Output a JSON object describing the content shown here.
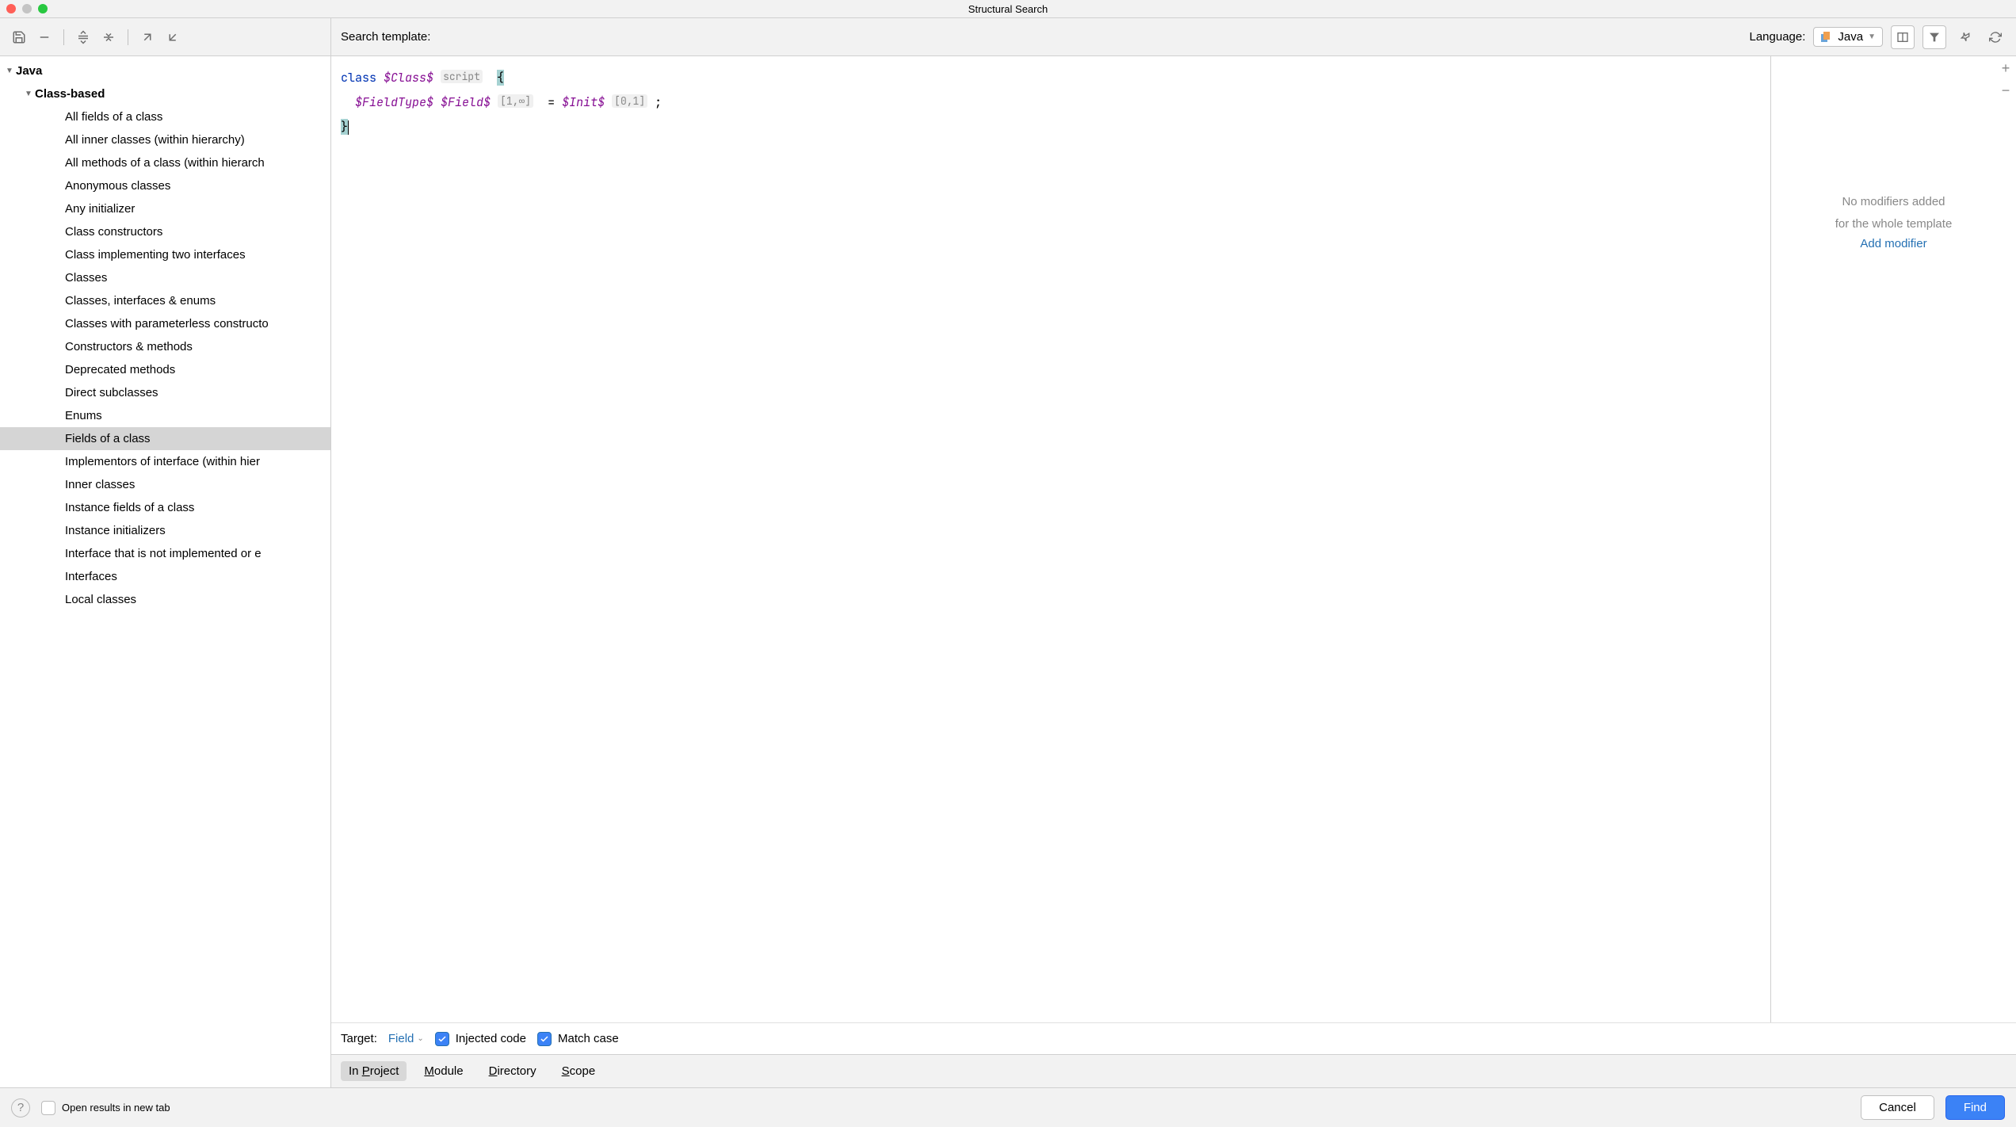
{
  "window": {
    "title": "Structural Search"
  },
  "tree": {
    "root": {
      "label": "Java"
    },
    "group": {
      "label": "Class-based"
    },
    "items": [
      "All fields of a class",
      "All inner classes (within hierarchy)",
      "All methods of a class (within hierarch",
      "Anonymous classes",
      "Any initializer",
      "Class constructors",
      "Class implementing two interfaces",
      "Classes",
      "Classes, interfaces & enums",
      "Classes with parameterless constructo",
      "Constructors & methods",
      "Deprecated methods",
      "Direct subclasses",
      "Enums",
      "Fields of a class",
      "Implementors of interface (within hier",
      "Inner classes",
      "Instance fields of a class",
      "Instance initializers",
      "Interface that is not implemented or e",
      "Interfaces",
      "Local classes"
    ],
    "selected_index": 14
  },
  "header": {
    "label": "Search template:",
    "language_label": "Language:",
    "language_value": "Java"
  },
  "code": {
    "kw_class": "class",
    "var_class": "$Class$",
    "badge_script": "script",
    "brace_open": "{",
    "var_fieldtype": "$FieldType$",
    "var_field": "$Field$",
    "badge_count1": "[1,∞]",
    "eq": " = ",
    "var_init": "$Init$",
    "badge_count2": "[0,1]",
    "semicolon": " ;",
    "brace_close": "}"
  },
  "modifiers": {
    "line1": "No modifiers added",
    "line2": "for the whole template",
    "link": "Add modifier"
  },
  "target": {
    "label": "Target:",
    "value": "Field",
    "injected_label": "Injected code",
    "match_case_label": "Match case",
    "injected_checked": true,
    "match_case_checked": true
  },
  "scope": {
    "tabs": [
      "In Project",
      "Module",
      "Directory",
      "Scope"
    ],
    "selected": 0,
    "underline_chars": [
      "P",
      "M",
      "D",
      "S"
    ]
  },
  "footer": {
    "open_results_label": "Open results in new tab",
    "cancel": "Cancel",
    "find": "Find"
  }
}
